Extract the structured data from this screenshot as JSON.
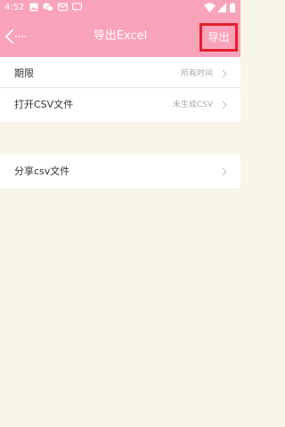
{
  "status_bar": {
    "time": "4:52",
    "left_icons": [
      "image-icon",
      "wechat-icon",
      "mail-icon",
      "message-icon"
    ],
    "right_icons": [
      "wifi-icon",
      "signal-icon",
      "battery-icon"
    ]
  },
  "toolbar": {
    "title": "导出Excel",
    "export_label": "导出",
    "back_icon": "back-arrow-icon"
  },
  "rows": [
    {
      "label": "期限",
      "value": "所有时间"
    },
    {
      "label": "打开CSV文件",
      "value": "未生成CSV"
    },
    {
      "label": "分享csv文件",
      "value": ""
    }
  ],
  "colors": {
    "toolbar_bg": "#f9a3bb",
    "page_bg": "#f8f6e8",
    "highlight_border": "#e41f2a"
  }
}
